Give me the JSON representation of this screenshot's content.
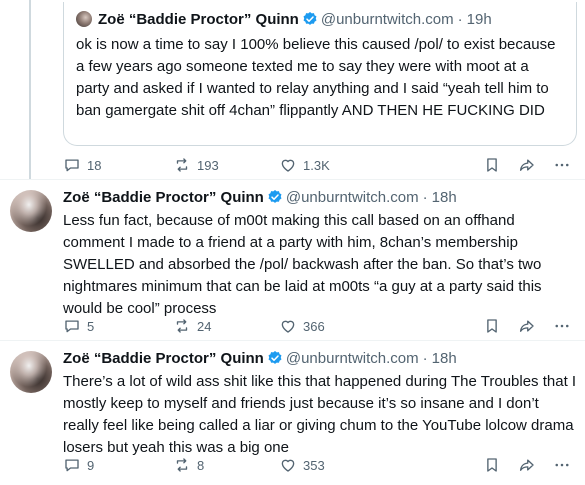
{
  "quote": {
    "author_name": "Zoë “Baddie Proctor” Quinn",
    "handle": "@unburntwitch.com",
    "time": "19h",
    "text": "ok is now a time to say I 100% believe this caused /pol/ to exist because a few years ago someone texted me to say they were with moot at a party and asked if I wanted to relay anything and I said “yeah tell him to ban gamergate shit off 4chan” flippantly AND THEN HE FUCKING DID",
    "replies": "18",
    "reposts": "193",
    "likes": "1.3K"
  },
  "posts": [
    {
      "author_name": "Zoë “Baddie Proctor” Quinn",
      "handle": "@unburntwitch.com",
      "time": "18h",
      "text": "Less fun fact, because of m00t making this call based on an offhand comment I made to a friend at a party with him, 8chan’s membership SWELLED and absorbed the /pol/ backwash after the ban. So that’s two nightmares minimum that can be laid at m00ts “a guy at a party said this would be cool” process",
      "replies": "5",
      "reposts": "24",
      "likes": "366"
    },
    {
      "author_name": "Zoë “Baddie Proctor” Quinn",
      "handle": "@unburntwitch.com",
      "time": "18h",
      "text": "There’s a lot of wild ass shit like this that happened during The Troubles that I mostly keep to myself and friends just because it’s so insane and I don’t really feel like being called a liar or giving chum to the YouTube lolcow drama losers but yeah this was a big one",
      "replies": "9",
      "reposts": "8",
      "likes": "353"
    }
  ],
  "separator": "·",
  "colors": {
    "verified": "#1d9bf0",
    "secondary_text": "#536471",
    "border": "#cfd9de"
  },
  "icons": [
    "verified-badge-icon",
    "reply-icon",
    "repost-icon",
    "like-icon",
    "bookmark-icon",
    "share-icon",
    "more-icon"
  ]
}
